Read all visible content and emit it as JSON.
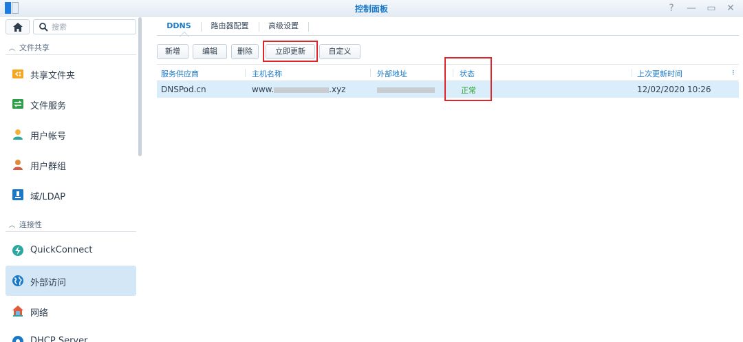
{
  "window": {
    "title": "控制面板",
    "controls": [
      "?",
      "—",
      "▭",
      "✕"
    ]
  },
  "sidebar": {
    "search_placeholder": "搜索",
    "sections": [
      {
        "label": "文件共享"
      },
      {
        "label": "连接性"
      }
    ],
    "items": [
      {
        "label": "共享文件夹",
        "icon": "shared-folder-icon",
        "color": "#f5a623"
      },
      {
        "label": "文件服务",
        "icon": "file-services-icon",
        "color": "#2e9e4a"
      },
      {
        "label": "用户帐号",
        "icon": "user-icon",
        "color": "#f2b33d"
      },
      {
        "label": "用户群组",
        "icon": "group-icon",
        "color": "#e08a3c"
      },
      {
        "label": "域/LDAP",
        "icon": "ldap-icon",
        "color": "#1b79c8"
      },
      {
        "label": "QuickConnect",
        "icon": "quickconnect-icon",
        "color": "#2ba6a0"
      },
      {
        "label": "外部访问",
        "icon": "globe-icon",
        "color": "#1b79c8",
        "active": true
      },
      {
        "label": "网络",
        "icon": "network-home-icon",
        "color": "#e05a3c"
      },
      {
        "label": "DHCP Server",
        "icon": "dhcp-icon",
        "color": "#1b79c8"
      }
    ]
  },
  "tabs": [
    {
      "label": "DDNS",
      "active": true
    },
    {
      "label": "路由器配置"
    },
    {
      "label": "高级设置"
    }
  ],
  "toolbar": {
    "add": "新增",
    "edit": "编辑",
    "delete": "删除",
    "update_now": "立即更新",
    "custom": "自定义"
  },
  "table": {
    "columns": [
      "服务供应商",
      "主机名称",
      "外部地址",
      "状态",
      "上次更新时间"
    ],
    "rows": [
      {
        "provider": "DNSPod.cn",
        "host_prefix": "www.",
        "host_suffix": ".xyz",
        "external_address": "",
        "status": "正常",
        "last_update": "12/02/2020 10:26"
      }
    ]
  },
  "colors": {
    "accent": "#1b79c8",
    "highlight": "#e0242a",
    "status_ok": "#2ba22b",
    "selected_row": "#daedfb"
  }
}
